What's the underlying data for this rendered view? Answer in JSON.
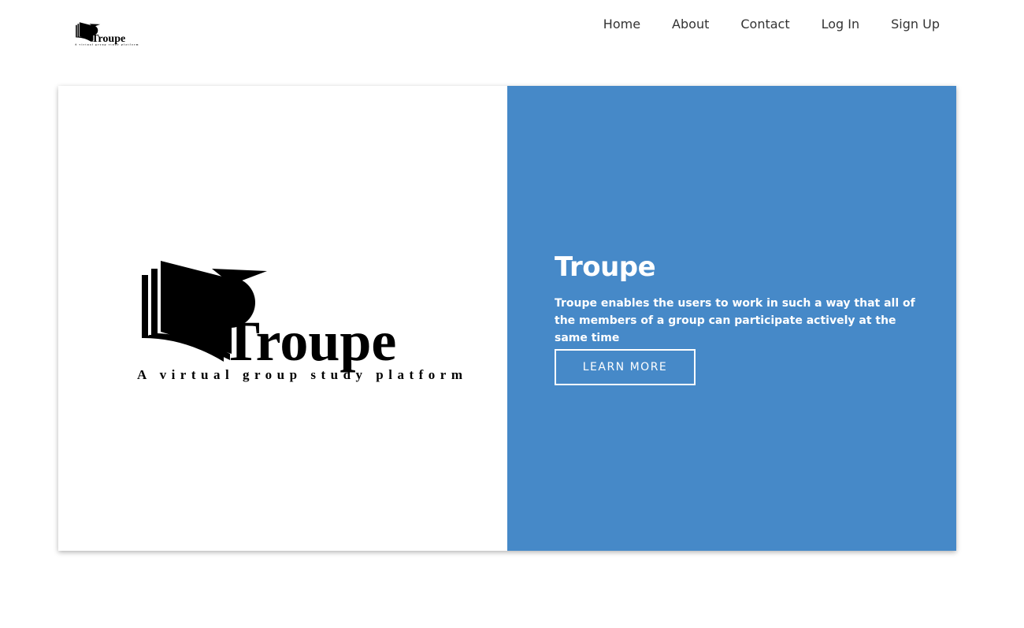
{
  "header": {
    "logo_title": "Troupe",
    "logo_tagline": "A virtual group study platform",
    "nav": [
      {
        "label": "Home"
      },
      {
        "label": "About"
      },
      {
        "label": "Contact"
      },
      {
        "label": "Log In"
      },
      {
        "label": "Sign Up"
      }
    ]
  },
  "hero": {
    "logo_title": "Troupe",
    "logo_tagline": "A virtual group study platform",
    "title": "Troupe",
    "description": "Troupe enables the users to work in such a way that all of the members of a group can participate actively at the same time",
    "button_label": "LEARN MORE"
  },
  "colors": {
    "accent": "#4689c8",
    "background": "#ffffff",
    "text_on_accent": "#ffffff"
  },
  "icons": {
    "logo": "book-graduation-cap-logo"
  }
}
